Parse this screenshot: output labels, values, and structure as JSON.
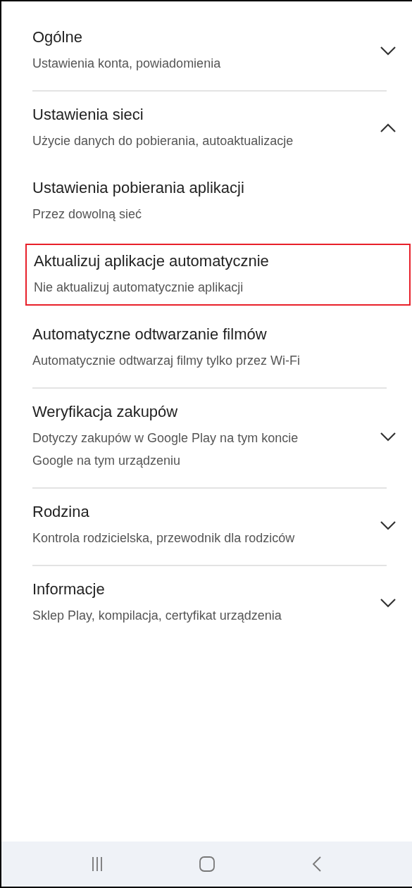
{
  "sections": [
    {
      "title": "Ogólne",
      "subtitle": "Ustawienia konta, powiadomienia",
      "expanded": false
    },
    {
      "title": "Ustawienia sieci",
      "subtitle": "Użycie danych do pobierania, autoaktualizacje",
      "expanded": true,
      "children": [
        {
          "title": "Ustawienia pobierania aplikacji",
          "subtitle": "Przez dowolną sieć",
          "highlighted": false
        },
        {
          "title": "Aktualizuj aplikacje automatycznie",
          "subtitle": "Nie aktualizuj automatycznie aplikacji",
          "highlighted": true
        },
        {
          "title": "Automatyczne odtwarzanie filmów",
          "subtitle": "Automatycznie odtwarzaj filmy tylko przez Wi-Fi",
          "highlighted": false
        }
      ]
    },
    {
      "title": "Weryfikacja zakupów",
      "subtitle": "Dotyczy zakupów w Google Play na tym koncie Google na tym urządzeniu",
      "expanded": false
    },
    {
      "title": "Rodzina",
      "subtitle": "Kontrola rodzicielska, przewodnik dla rodziców",
      "expanded": false
    },
    {
      "title": "Informacje",
      "subtitle": "Sklep Play, kompilacja, certyfikat urządzenia",
      "expanded": false
    }
  ]
}
